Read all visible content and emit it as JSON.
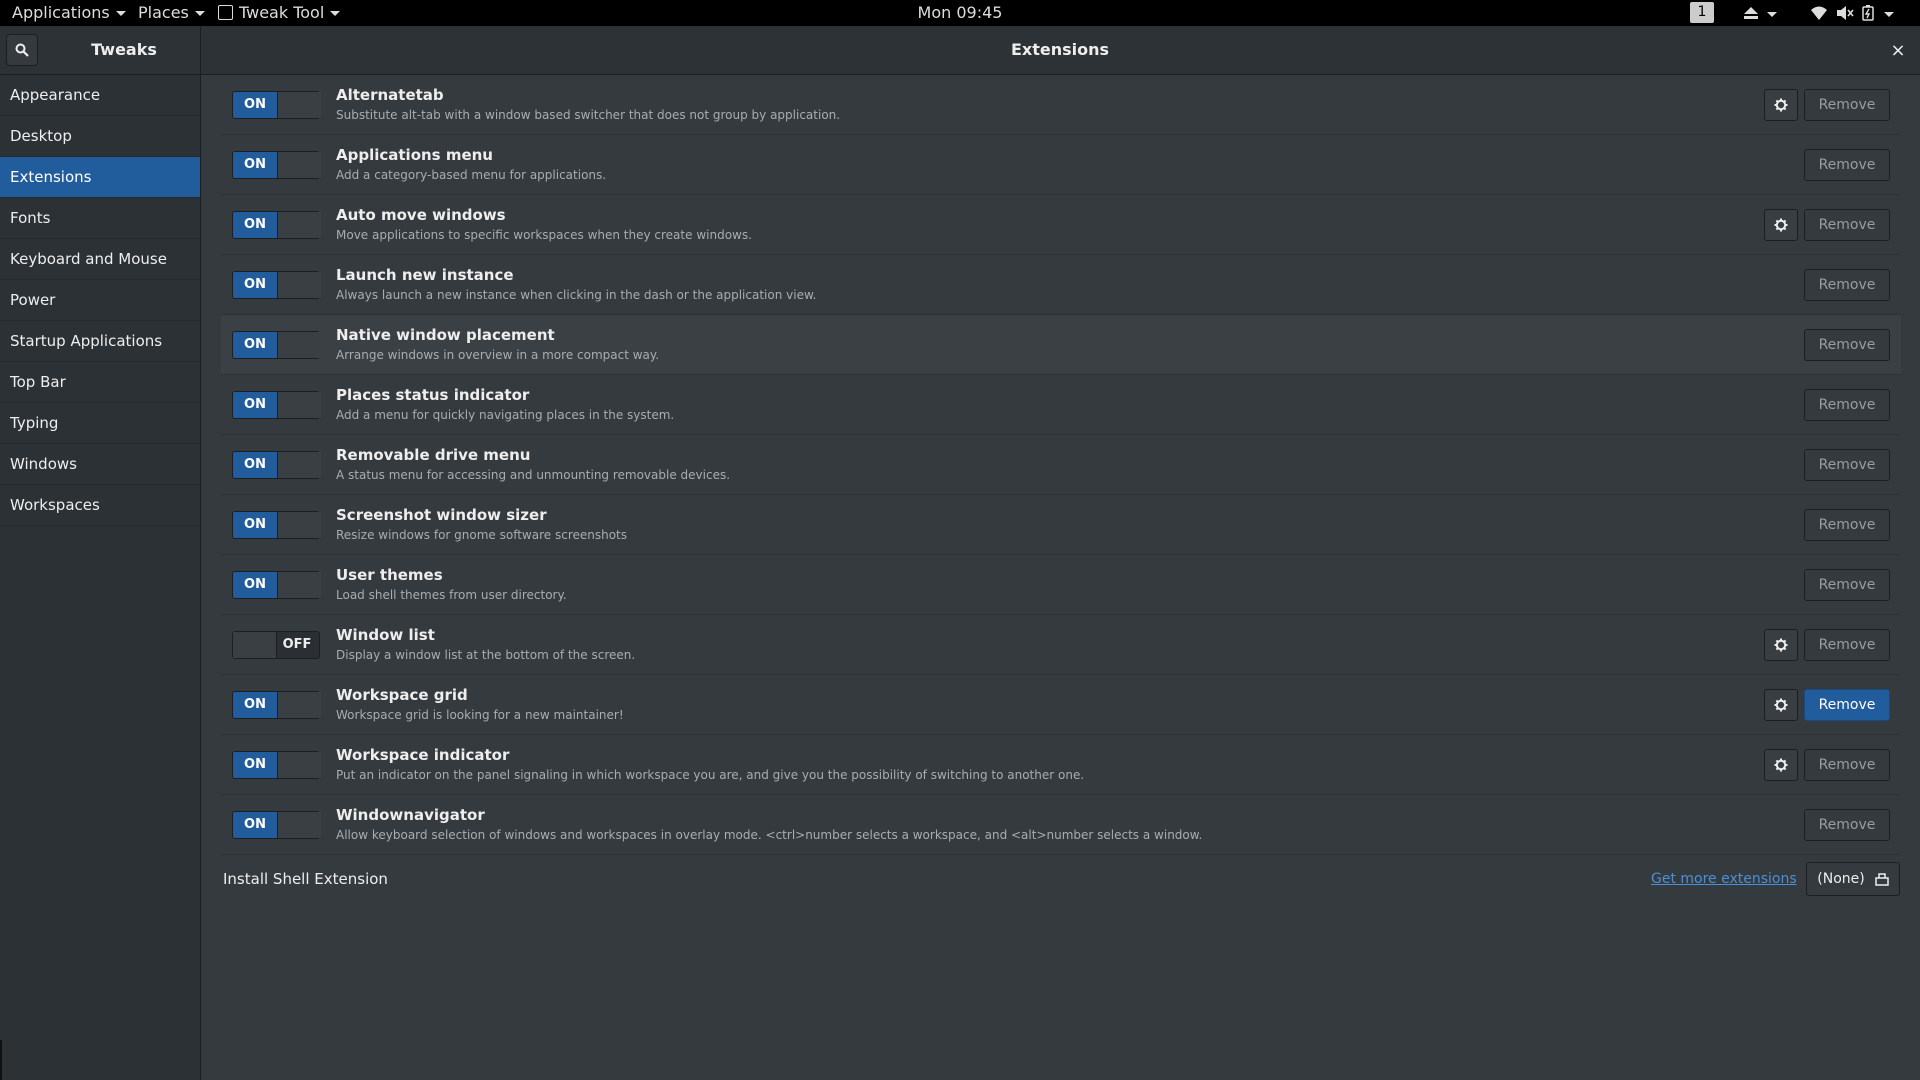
{
  "topbar": {
    "applications_label": "Applications",
    "places_label": "Places",
    "app_label": "Tweak Tool",
    "clock": "Mon 09:45",
    "workspace_number": "1"
  },
  "header": {
    "sidebar_title": "Tweaks",
    "page_title": "Extensions",
    "close_glyph": "×"
  },
  "sidebar": {
    "items": [
      {
        "label": "Appearance"
      },
      {
        "label": "Desktop"
      },
      {
        "label": "Extensions",
        "active": true
      },
      {
        "label": "Fonts"
      },
      {
        "label": "Keyboard and Mouse"
      },
      {
        "label": "Power"
      },
      {
        "label": "Startup Applications"
      },
      {
        "label": "Top Bar"
      },
      {
        "label": "Typing"
      },
      {
        "label": "Windows"
      },
      {
        "label": "Workspaces"
      }
    ]
  },
  "switch_labels": {
    "on": "ON",
    "off": "OFF"
  },
  "remove_label": "Remove",
  "extensions": [
    {
      "name": "Alternatetab",
      "description": "Substitute alt-tab with a window based switcher that does not group by application.",
      "enabled": true,
      "has_settings": true
    },
    {
      "name": "Applications menu",
      "description": "Add a category-based menu for applications.",
      "enabled": true,
      "has_settings": false
    },
    {
      "name": "Auto move windows",
      "description": "Move applications to specific workspaces when they create windows.",
      "enabled": true,
      "has_settings": true
    },
    {
      "name": "Launch new instance",
      "description": "Always launch a new instance when clicking in the dash or the application view.",
      "enabled": true,
      "has_settings": false
    },
    {
      "name": "Native window placement",
      "description": "Arrange windows in overview in a more compact way.",
      "enabled": true,
      "has_settings": false,
      "hovered": true
    },
    {
      "name": "Places status indicator",
      "description": "Add a menu for quickly navigating places in the system.",
      "enabled": true,
      "has_settings": false
    },
    {
      "name": "Removable drive menu",
      "description": "A status menu for accessing and unmounting removable devices.",
      "enabled": true,
      "has_settings": false
    },
    {
      "name": "Screenshot window sizer",
      "description": "Resize windows for gnome software screenshots",
      "enabled": true,
      "has_settings": false
    },
    {
      "name": "User themes",
      "description": "Load shell themes from user directory.",
      "enabled": true,
      "has_settings": false
    },
    {
      "name": "Window list",
      "description": "Display a window list at the bottom of the screen.",
      "enabled": false,
      "has_settings": true
    },
    {
      "name": "Workspace grid",
      "description": "Workspace grid is looking for a new maintainer!",
      "enabled": true,
      "has_settings": true,
      "remove_highlighted": true
    },
    {
      "name": "Workspace indicator",
      "description": "Put an indicator on the panel signaling in which workspace you are, and give you the possibility of switching to another one.",
      "enabled": true,
      "has_settings": true
    },
    {
      "name": "Windownavigator",
      "description": "Allow keyboard selection of windows and workspaces in overlay mode. <ctrl>number selects a workspace, and <alt>number selects a window.",
      "enabled": true,
      "has_settings": false
    }
  ],
  "install": {
    "label": "Install Shell Extension",
    "link": "Get more extensions",
    "file_button": "(None)"
  },
  "colors": {
    "accent": "#215d9c",
    "background": "#353a3e",
    "link": "#4a90d9"
  }
}
